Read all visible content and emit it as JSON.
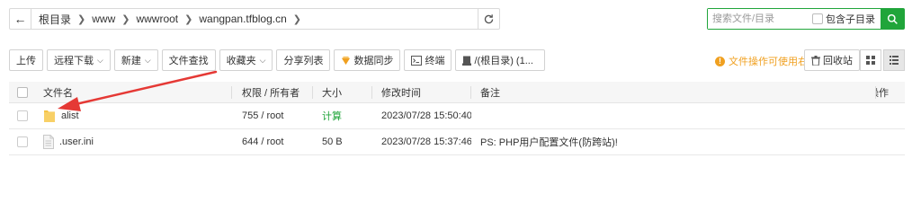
{
  "pathbar": {
    "crumbs": [
      "根目录",
      "www",
      "wwwroot",
      "wangpan.tfblog.cn"
    ]
  },
  "search": {
    "placeholder": "搜索文件/目录",
    "include_subdir_label": "包含子目录"
  },
  "toolbar": {
    "upload": "上传",
    "remote_download": "远程下载",
    "new": "新建",
    "file_search": "文件查找",
    "favorites": "收藏夹",
    "share_list": "分享列表",
    "data_sync": "数据同步",
    "terminal": "终端",
    "disk": "/(根目录) (1..."
  },
  "tip": {
    "text": "文件操作可使用右键"
  },
  "recycle": {
    "label": "回收站"
  },
  "table": {
    "headers": {
      "name": "文件名",
      "perm": "权限 / 所有者",
      "size": "大小",
      "mtime": "修改时间",
      "note": "备注",
      "ops": "操作"
    },
    "rows": [
      {
        "name": "alist",
        "type": "folder",
        "perm": "755 / root",
        "size": "计算",
        "mtime": "2023/07/28 15:50:40",
        "note": ""
      },
      {
        "name": ".user.ini",
        "type": "file",
        "perm": "644 / root",
        "size": "50 B",
        "mtime": "2023/07/28 15:37:46",
        "note": "PS: PHP用户配置文件(防跨站)!"
      }
    ]
  },
  "colors": {
    "accent": "#20a53a",
    "warning": "#f0a020",
    "annotation_arrow": "#e53935",
    "folder": "#f5c344"
  },
  "icons": [
    "arrow-left-icon",
    "chevron-right-icon",
    "refresh-icon",
    "search-icon",
    "chevron-down-icon",
    "sync-icon",
    "terminal-icon",
    "disk-icon",
    "info-icon",
    "trash-icon",
    "grid-view-icon",
    "list-view-icon",
    "folder-icon",
    "file-icon"
  ]
}
